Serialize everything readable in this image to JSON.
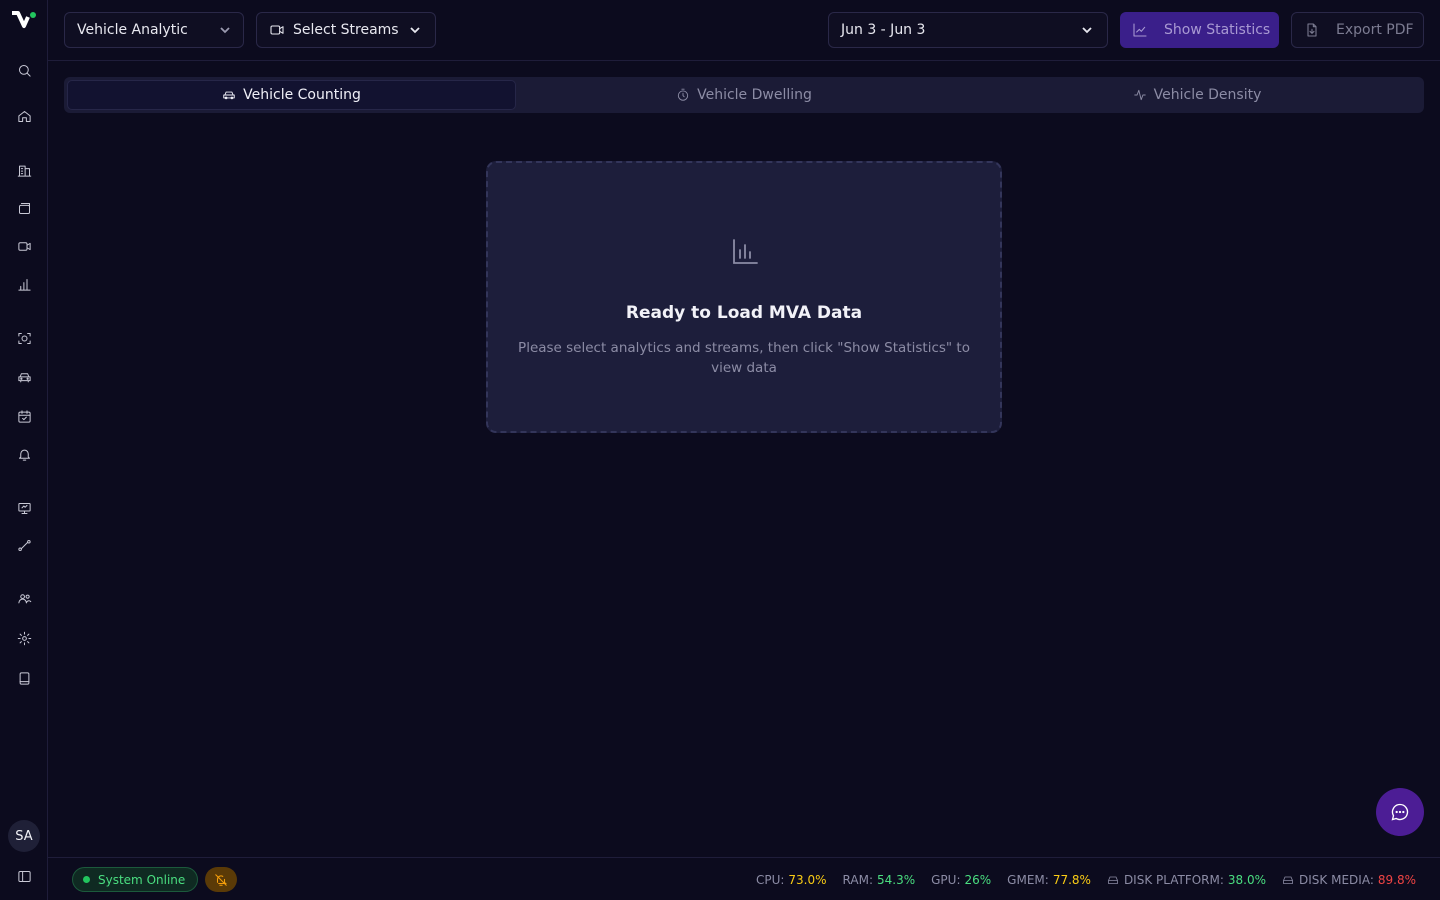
{
  "header": {
    "analytic_select": "Vehicle Analytic",
    "streams_select": "Select Streams",
    "date_range": "Jun 3 - Jun 3",
    "show_statistics": "Show Statistics",
    "export_pdf": "Export PDF"
  },
  "tabs": [
    {
      "label": "Vehicle Counting",
      "icon": "car-icon",
      "active": true
    },
    {
      "label": "Vehicle Dwelling",
      "icon": "timer-icon",
      "active": false
    },
    {
      "label": "Vehicle Density",
      "icon": "activity-icon",
      "active": false
    }
  ],
  "empty_state": {
    "icon": "bar-chart-icon",
    "title": "Ready to Load MVA Data",
    "description": "Please select analytics and streams, then click \"Show Statistics\" to view data"
  },
  "sidebar": {
    "items": [
      "search-icon",
      "home-icon",
      "building-icon",
      "layers-icon",
      "video-icon",
      "chart-icon",
      "face-scan-icon",
      "car-icon",
      "calendar-check-icon",
      "bell-icon",
      "presentation-icon",
      "route-icon",
      "users-icon",
      "settings-icon",
      "book-icon"
    ],
    "avatar": "SA"
  },
  "footer": {
    "status": "System Online",
    "metrics": [
      {
        "label": "CPU:",
        "value": "73.0%",
        "color": "#facc15"
      },
      {
        "label": "RAM:",
        "value": "54.3%",
        "color": "#4ade80"
      },
      {
        "label": "GPU:",
        "value": "26%",
        "color": "#4ade80"
      },
      {
        "label": "GMEM:",
        "value": "77.8%",
        "color": "#facc15"
      },
      {
        "label": "DISK PLATFORM:",
        "value": "38.0%",
        "color": "#4ade80"
      },
      {
        "label": "DISK MEDIA:",
        "value": "89.8%",
        "color": "#ef4444"
      }
    ]
  },
  "colors": {
    "background": "#0c0b1e",
    "accent": "#3a1f8a",
    "card": "#1d1e3b"
  }
}
